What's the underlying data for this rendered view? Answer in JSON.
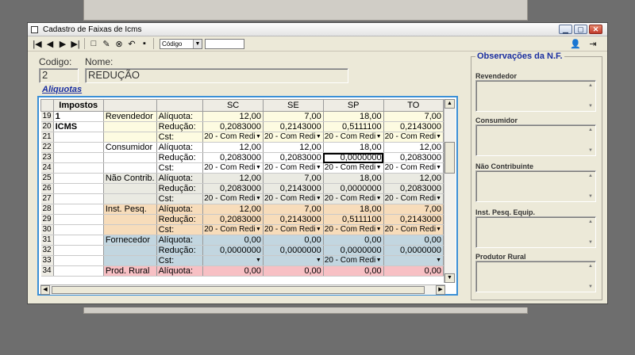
{
  "window": {
    "title": "Cadastro de Faixas de Icms"
  },
  "toolbar": {
    "search_by": "Código",
    "search_value": "",
    "icons": [
      "first-record-icon",
      "prev-record-icon",
      "next-record-icon",
      "last-record-icon",
      "new-icon",
      "edit-icon",
      "delete-icon",
      "undo-icon",
      "save-icon",
      "help-icon",
      "exit-icon"
    ]
  },
  "form": {
    "codigo_label": "Codigo:",
    "codigo_value": "2",
    "nome_label": "Nome:",
    "nome_value": "REDUÇÃO",
    "aliquotas_title": "Aliquotas"
  },
  "grid": {
    "header": {
      "impostos": "Impostos",
      "states": [
        "SC",
        "SE",
        "SP",
        "TO"
      ]
    },
    "imposto_codigo": "1",
    "imposto_nome": "ICMS",
    "groups": [
      {
        "name": "Revendedor",
        "color": "#fdfbe1",
        "rows": [
          {
            "n": "19",
            "label": "Alíquota:",
            "values": [
              "12,00",
              "7,00",
              "18,00",
              "7,00"
            ]
          },
          {
            "n": "20",
            "label": "Redução:",
            "values": [
              "0,2083000",
              "0,2143000",
              "0,5111100",
              "0,2143000"
            ]
          },
          {
            "n": "21",
            "label": "Cst:",
            "cst": [
              "20 - Com Redi",
              "20 - Com Redi",
              "20 - Com Redi",
              "20 - Com Redi"
            ]
          }
        ]
      },
      {
        "name": "Consumidor",
        "color": "#ffffff",
        "rows": [
          {
            "n": "22",
            "label": "Alíquota:",
            "values": [
              "12,00",
              "12,00",
              "18,00",
              "12,00"
            ]
          },
          {
            "n": "23",
            "label": "Redução:",
            "values": [
              "0,2083000",
              "0,2083000",
              "0,0000000",
              "0,2083000"
            ]
          },
          {
            "n": "24",
            "label": "Cst:",
            "cst": [
              "20 - Com Redi",
              "20 - Com Redi",
              "20 - Com Redi",
              "20 - Com Redi"
            ]
          }
        ]
      },
      {
        "name": "Não Contrib.",
        "color": "#eaeae2",
        "rows": [
          {
            "n": "25",
            "label": "Alíquota:",
            "values": [
              "12,00",
              "7,00",
              "18,00",
              "12,00"
            ]
          },
          {
            "n": "26",
            "label": "Redução:",
            "values": [
              "0,2083000",
              "0,2143000",
              "0,0000000",
              "0,2083000"
            ]
          },
          {
            "n": "27",
            "label": "Cst:",
            "cst": [
              "20 - Com Redi",
              "20 - Com Redi",
              "20 - Com Redi",
              "20 - Com Redi"
            ]
          }
        ]
      },
      {
        "name": "Inst. Pesq.",
        "color": "#f7dcba",
        "rows": [
          {
            "n": "28",
            "label": "Alíquota:",
            "values": [
              "12,00",
              "7,00",
              "18,00",
              "7,00"
            ]
          },
          {
            "n": "29",
            "label": "Redução:",
            "values": [
              "0,2083000",
              "0,2143000",
              "0,5111100",
              "0,2143000"
            ]
          },
          {
            "n": "30",
            "label": "Cst:",
            "cst": [
              "20 - Com Redi",
              "20 - Com Redi",
              "20 - Com Redi",
              "20 - Com Redi"
            ]
          }
        ]
      },
      {
        "name": "Fornecedor",
        "color": "#c2d6e0",
        "rows": [
          {
            "n": "31",
            "label": "Alíquota:",
            "values": [
              "0,00",
              "0,00",
              "0,00",
              "0,00"
            ]
          },
          {
            "n": "32",
            "label": "Redução:",
            "values": [
              "0,0000000",
              "0,0000000",
              "0,0000000",
              "0,0000000"
            ]
          },
          {
            "n": "33",
            "label": "Cst:",
            "cst": [
              "",
              "",
              "20 - Com Redi",
              ""
            ]
          }
        ]
      },
      {
        "name": "Prod. Rural",
        "color": "#f7c0c4",
        "rows": [
          {
            "n": "34",
            "label": "Alíquota:",
            "values": [
              "0,00",
              "0,00",
              "0,00",
              "0,00"
            ]
          }
        ]
      }
    ]
  },
  "observacoes": {
    "title": "Observações da N.F.",
    "fields": [
      "Revendedor",
      "Consumidor",
      "Não Contribuinte",
      "Inst. Pesq. Equip.",
      "Produtor Rural"
    ]
  }
}
